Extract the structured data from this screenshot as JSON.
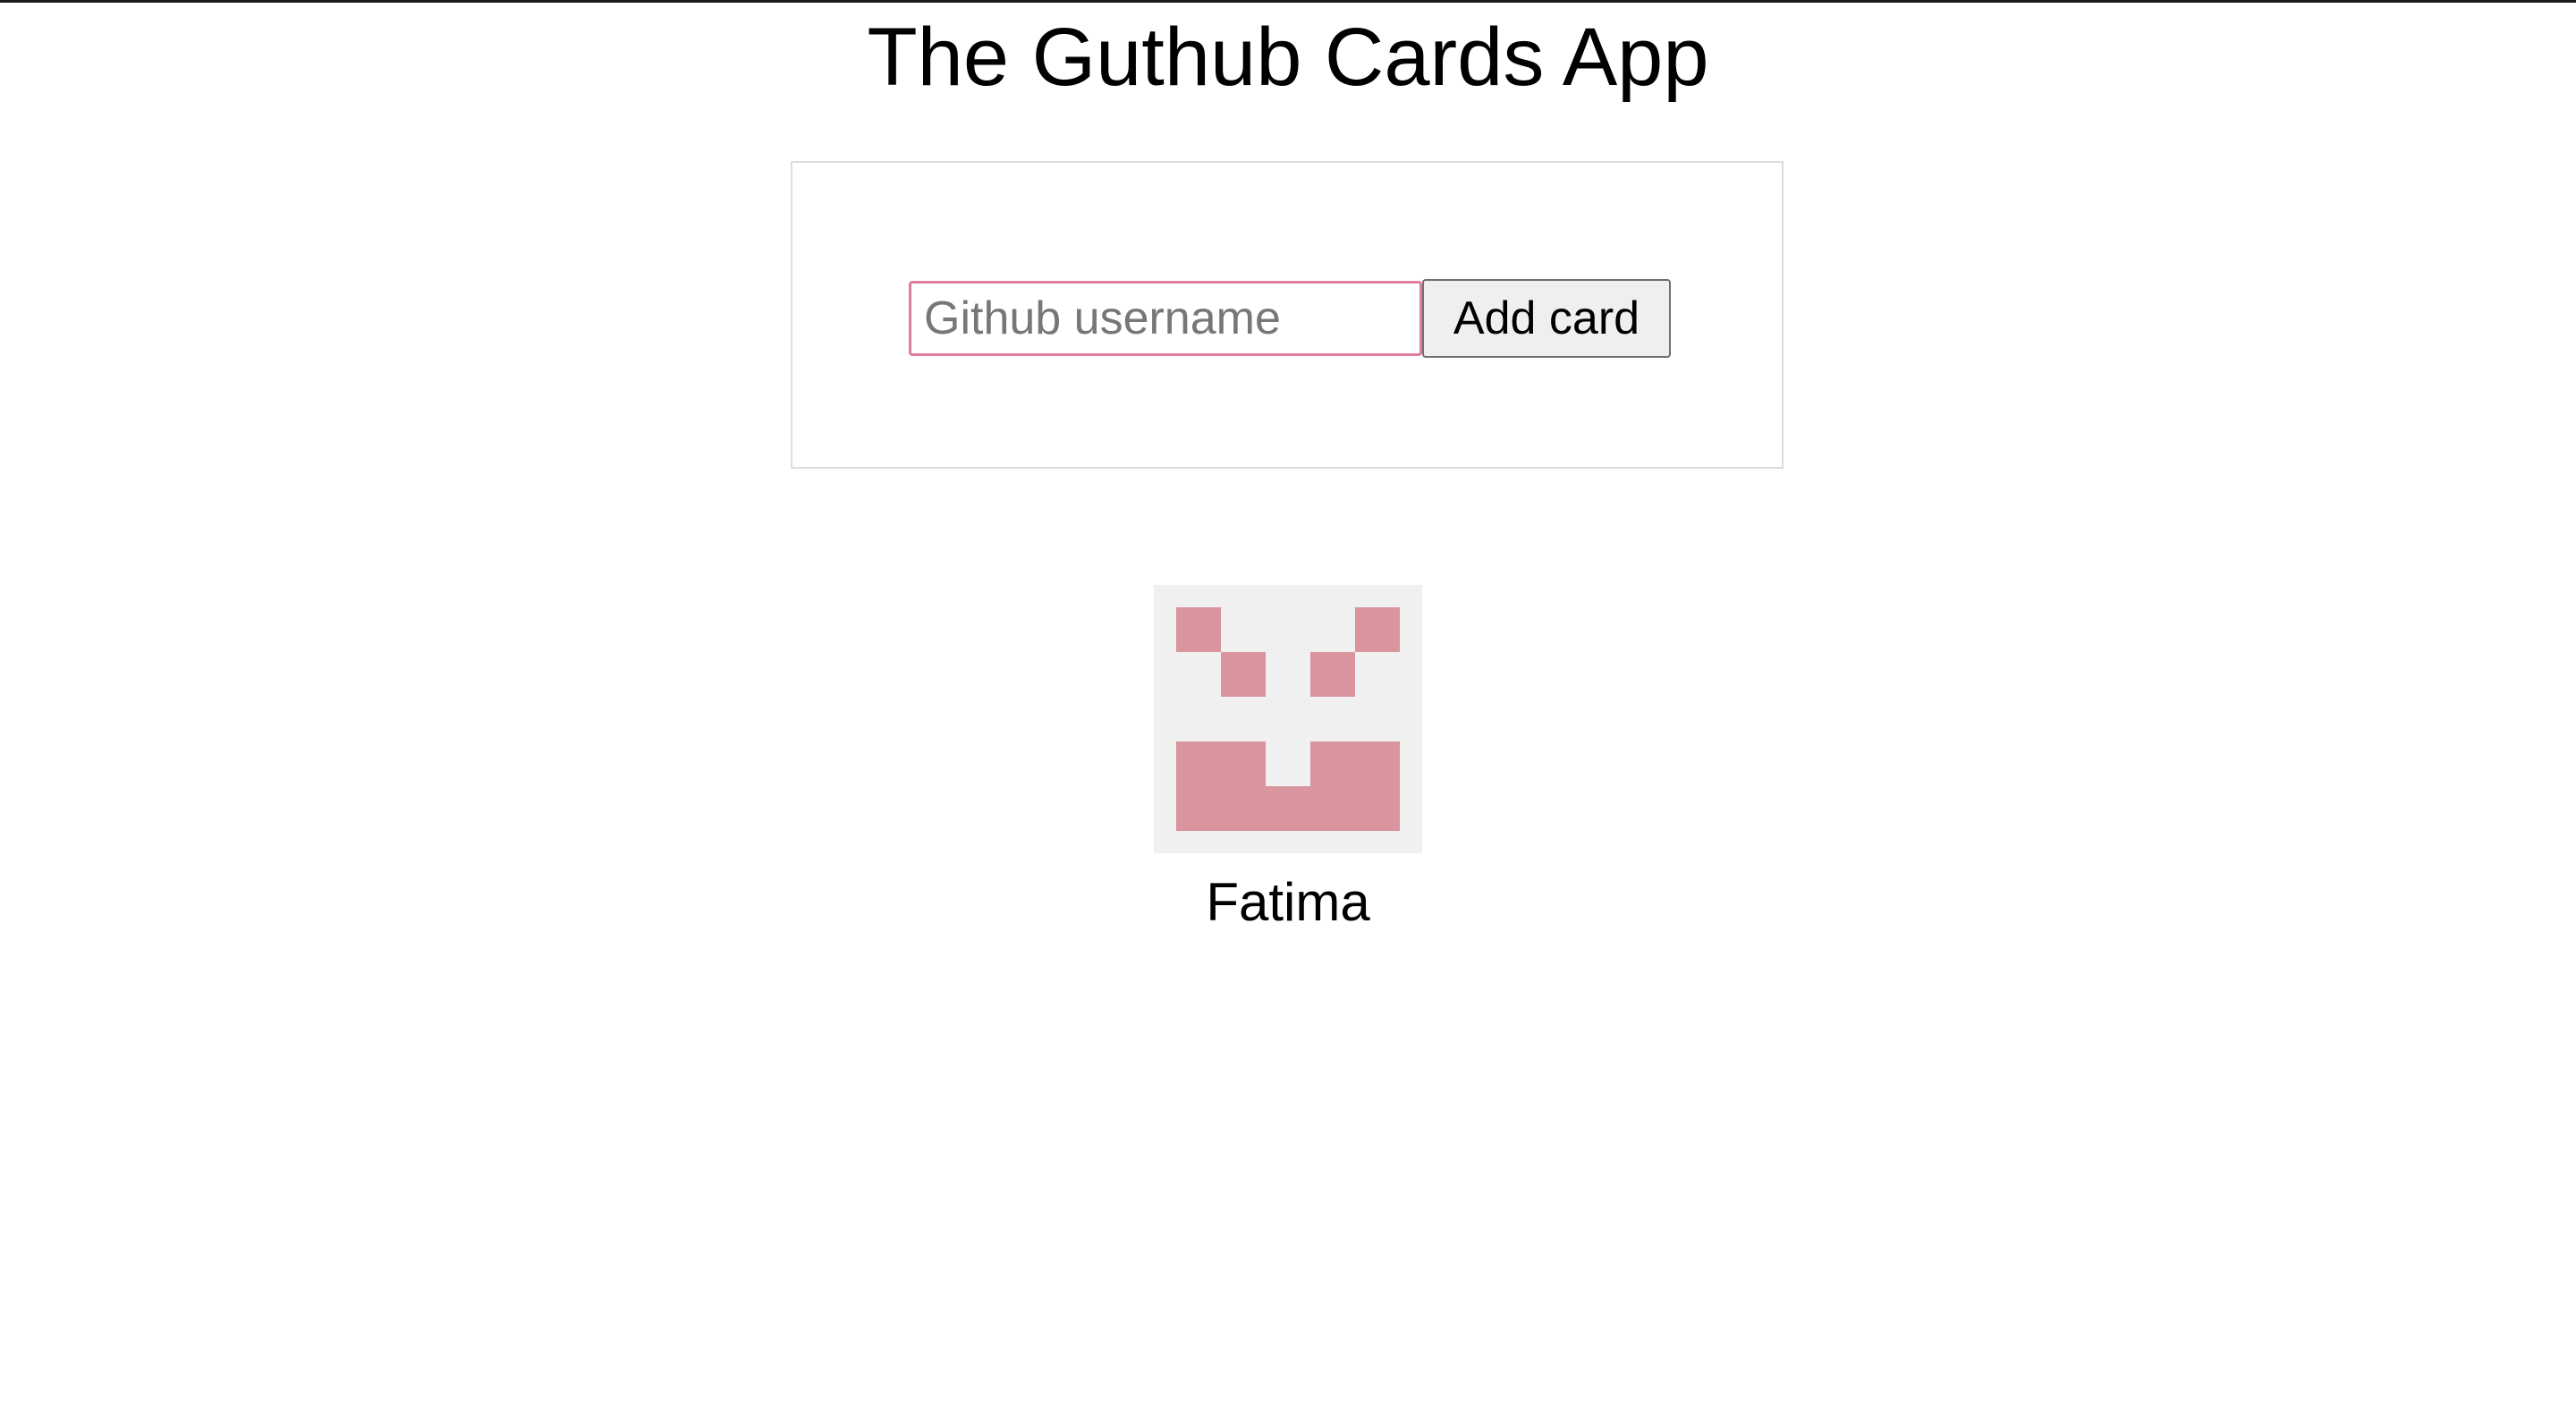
{
  "app": {
    "title": "The Guthub Cards App"
  },
  "form": {
    "placeholder": "Github username",
    "value": "",
    "submit_label": "Add card",
    "focus_border_color": "#e07ba3"
  },
  "cards": [
    {
      "name": "Fatima",
      "avatar_icon": "identicon-avatar",
      "avatar_color": "#d8959d",
      "avatar_bg": "#f0f0f0"
    }
  ]
}
